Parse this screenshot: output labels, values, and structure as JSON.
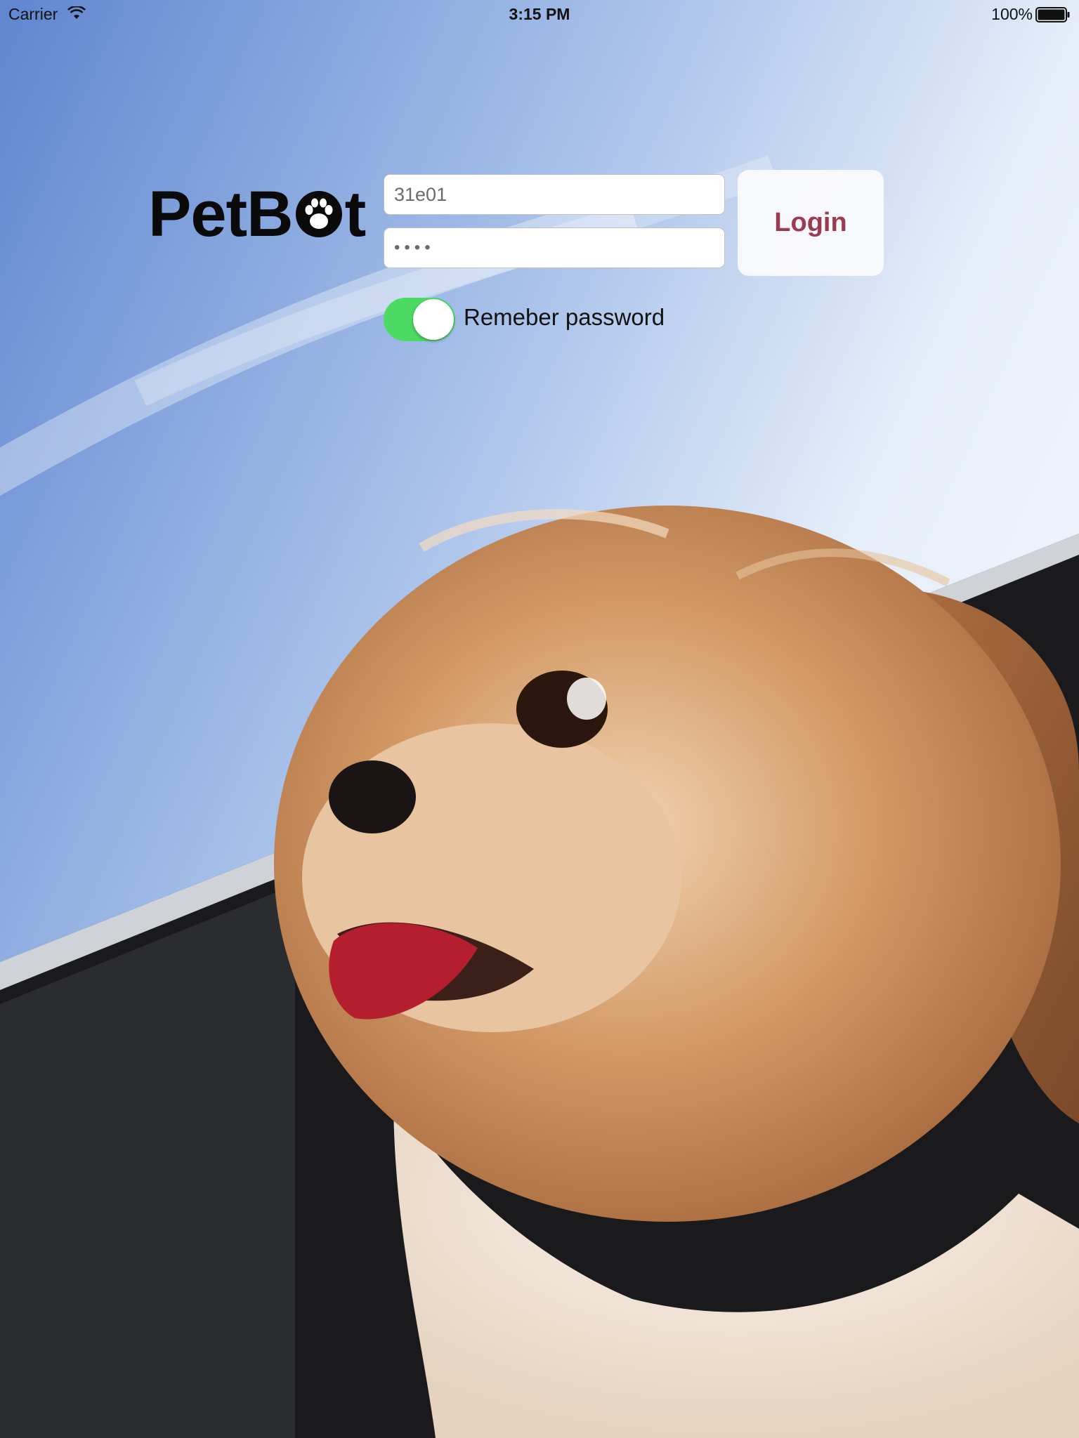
{
  "status_bar": {
    "carrier": "Carrier",
    "time": "3:15 PM",
    "battery_percent": "100%",
    "battery_level": 1.0,
    "wifi_icon": "wifi-icon",
    "battery_icon": "battery-icon"
  },
  "logo": {
    "text_left": "PetB",
    "text_right": "t",
    "icon": "paw-icon"
  },
  "login_form": {
    "username_value": "31e01",
    "password_value": "••••",
    "login_label": "Login",
    "remember_label": "Remeber password",
    "remember_on": true
  },
  "colors": {
    "toggle_on": "#4cd964",
    "login_text": "#9b3b50",
    "sky": "#6f95d8"
  }
}
